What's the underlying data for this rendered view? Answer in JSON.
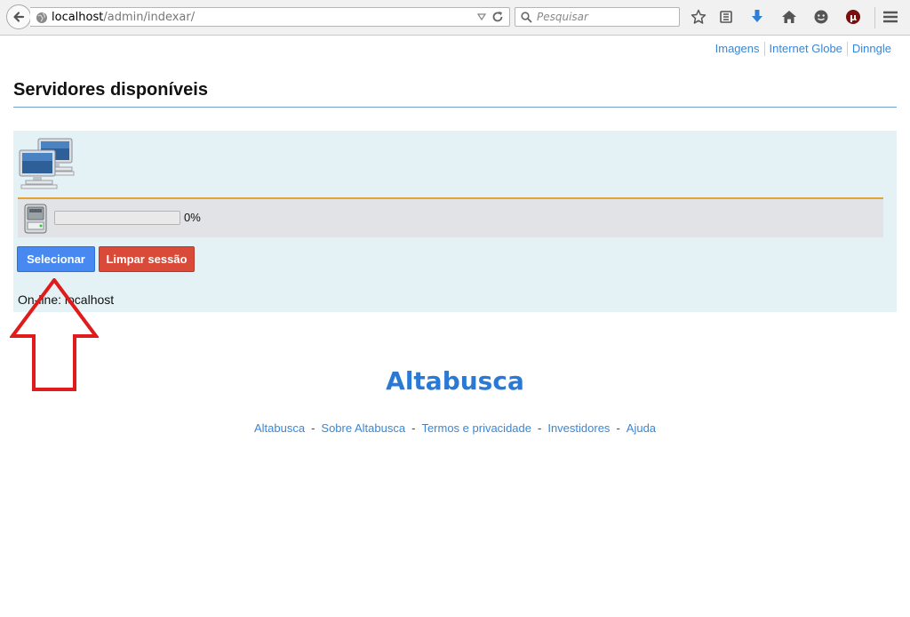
{
  "browser": {
    "url_host": "localhost",
    "url_path": "/admin/indexar/",
    "search_placeholder": "Pesquisar",
    "icons": [
      "back-arrow-icon",
      "globe-icon",
      "dropdown-icon",
      "reload-icon",
      "search-icon",
      "bookmark-star-icon",
      "reading-list-icon",
      "download-icon",
      "home-icon",
      "chat-icon",
      "utorrent-icon",
      "menu-icon"
    ]
  },
  "top_links": [
    "Imagens",
    "Internet Globe",
    "Dinngle"
  ],
  "page": {
    "title": "Servidores disponíveis"
  },
  "panel": {
    "progress_value": 0,
    "progress_text": "0%",
    "select_label": "Selecionar",
    "clear_label": "Limpar sessão",
    "online_text": "On-line: localhost"
  },
  "footer": {
    "brand": "Altabusca",
    "links": [
      "Altabusca",
      "Sobre Altabusca",
      "Termos e privacidade",
      "Investidores",
      "Ajuda"
    ]
  },
  "colors": {
    "link": "#3a86d4",
    "brand": "#2a7ad5",
    "select_button": "#4889f1",
    "clear_button": "#d94a38",
    "panel_bg": "#e4f2f5",
    "panel_rule": "#e4a332",
    "annotation_arrow": "#e01b1b"
  }
}
